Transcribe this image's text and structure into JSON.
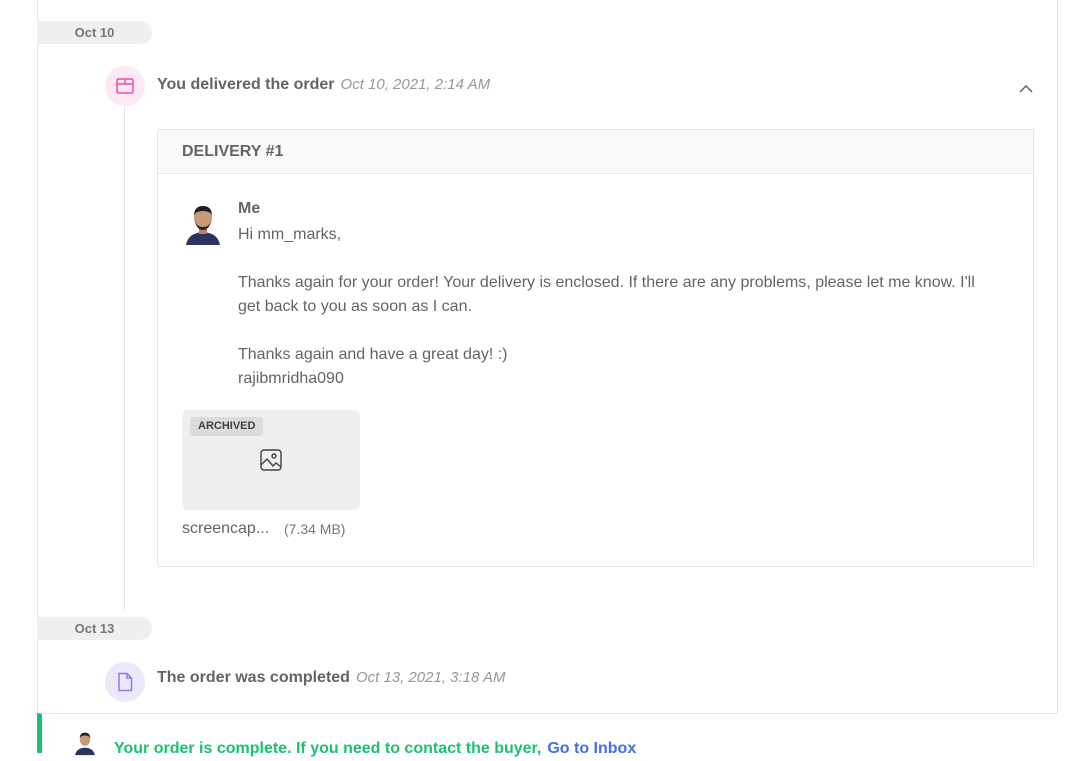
{
  "timeline": {
    "date1": "Oct 10",
    "event_delivered": {
      "title": "You delivered the order",
      "time": "Oct 10, 2021, 2:14 AM"
    },
    "delivery": {
      "header": "DELIVERY #1",
      "sender": "Me",
      "greeting": "Hi mm_marks,",
      "body": "Thanks again for your order! Your delivery is enclosed. If there are any problems, please let me know. I'll get back to you as soon as I can.",
      "closing": "Thanks again and have a great day! :)",
      "signature": "rajibmridha090",
      "attachment": {
        "badge": "ARCHIVED",
        "name": "screencap...",
        "size": "(7.34 MB)",
        "icon": "image-icon"
      }
    },
    "date2": "Oct 13",
    "event_completed": {
      "title": "The order was completed",
      "time": "Oct 13, 2021, 3:18 AM"
    },
    "complete_notice": {
      "text": "Your order is complete. If you need to contact the buyer,",
      "link": "Go to Inbox"
    }
  },
  "colors": {
    "accent_green": "#1dbf73",
    "link_blue": "#446ee7",
    "delivered_icon_bg": "#fde8f3",
    "delivered_icon": "#ec4fa1",
    "completed_icon_bg": "#ebe8fb",
    "completed_icon": "#8c7ae6"
  }
}
